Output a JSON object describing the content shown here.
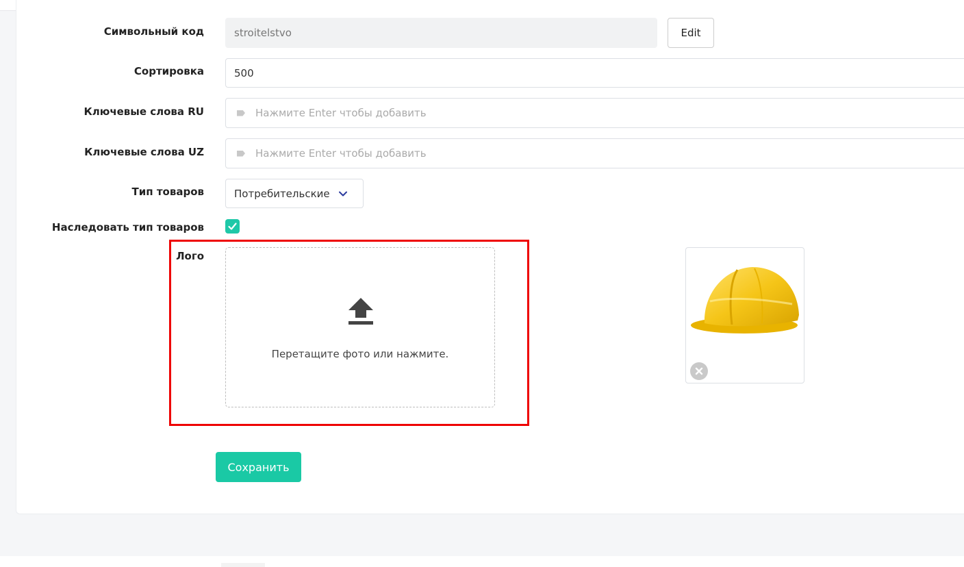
{
  "form": {
    "code": {
      "label": "Символьный код",
      "value": "stroitelstvo",
      "edit_label": "Edit"
    },
    "sort": {
      "label": "Сортировка",
      "value": "500"
    },
    "keywords_ru": {
      "label": "Ключевые слова RU",
      "placeholder": "Нажмите Enter чтобы добавить"
    },
    "keywords_uz": {
      "label": "Ключевые слова UZ",
      "placeholder": "Нажмите Enter чтобы добавить"
    },
    "product_type": {
      "label": "Тип товаров",
      "value": "Потребительские"
    },
    "inherit": {
      "label": "Наследовать тип товаров",
      "checked": true
    },
    "logo": {
      "label": "Лого",
      "dropzone_hint": "Перетащите фото или нажмите.",
      "preview_icon": "hard-hat-image"
    },
    "save_label": "Сохранить"
  },
  "colors": {
    "accent": "#1ac9a5",
    "highlight": "#ee0000",
    "chevron": "#2a3a9e"
  }
}
